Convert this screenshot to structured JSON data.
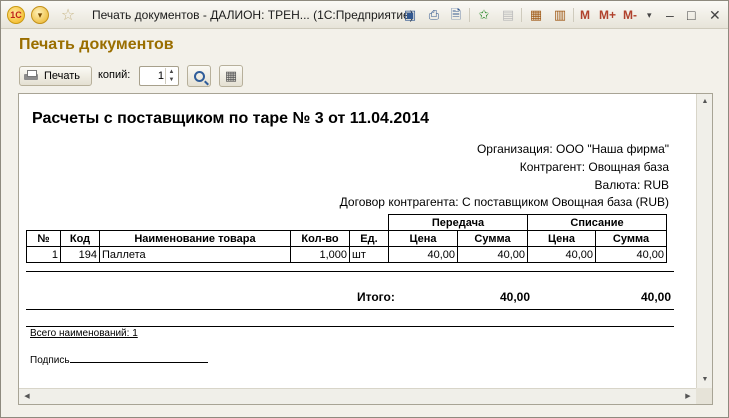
{
  "window": {
    "title": "Печать документов - ДАЛИОН: ТРЕН...  (1С:Предприятие)",
    "toolbar_letters": [
      "M",
      "M+",
      "M-"
    ],
    "controls": {
      "minimize": "–",
      "maximize": "□",
      "close": "✕"
    }
  },
  "form": {
    "title": "Печать документов",
    "print_button": "Печать",
    "copies_label": "копий:",
    "copies_value": "1"
  },
  "document": {
    "title": "Расчеты с поставщиком по таре № 3 от 11.04.2014",
    "info": [
      "Организация: ООО \"Наша фирма\"",
      "Контрагент: Овощная база",
      "Валюта: RUB",
      "Договор контрагента: С поставщиком Овощная база (RUB)"
    ],
    "table": {
      "group_headers": {
        "transfer": "Передача",
        "writeoff": "Списание"
      },
      "columns": [
        "№",
        "Код",
        "Наименование товара",
        "Кол-во",
        "Ед.",
        "Цена",
        "Сумма",
        "Цена",
        "Сумма"
      ],
      "rows": [
        [
          "1",
          "194",
          "Паллета",
          "1,000",
          "шт",
          "40,00",
          "40,00",
          "40,00",
          "40,00"
        ]
      ]
    },
    "total_label": "Итого:",
    "total_transfer": "40,00",
    "total_writeoff": "40,00",
    "summary": "Всего наименований: 1",
    "signature_label": "Подпись"
  },
  "colors": {
    "title_accent": "#9a6e00",
    "frame_bg": "#f3f1ea"
  }
}
